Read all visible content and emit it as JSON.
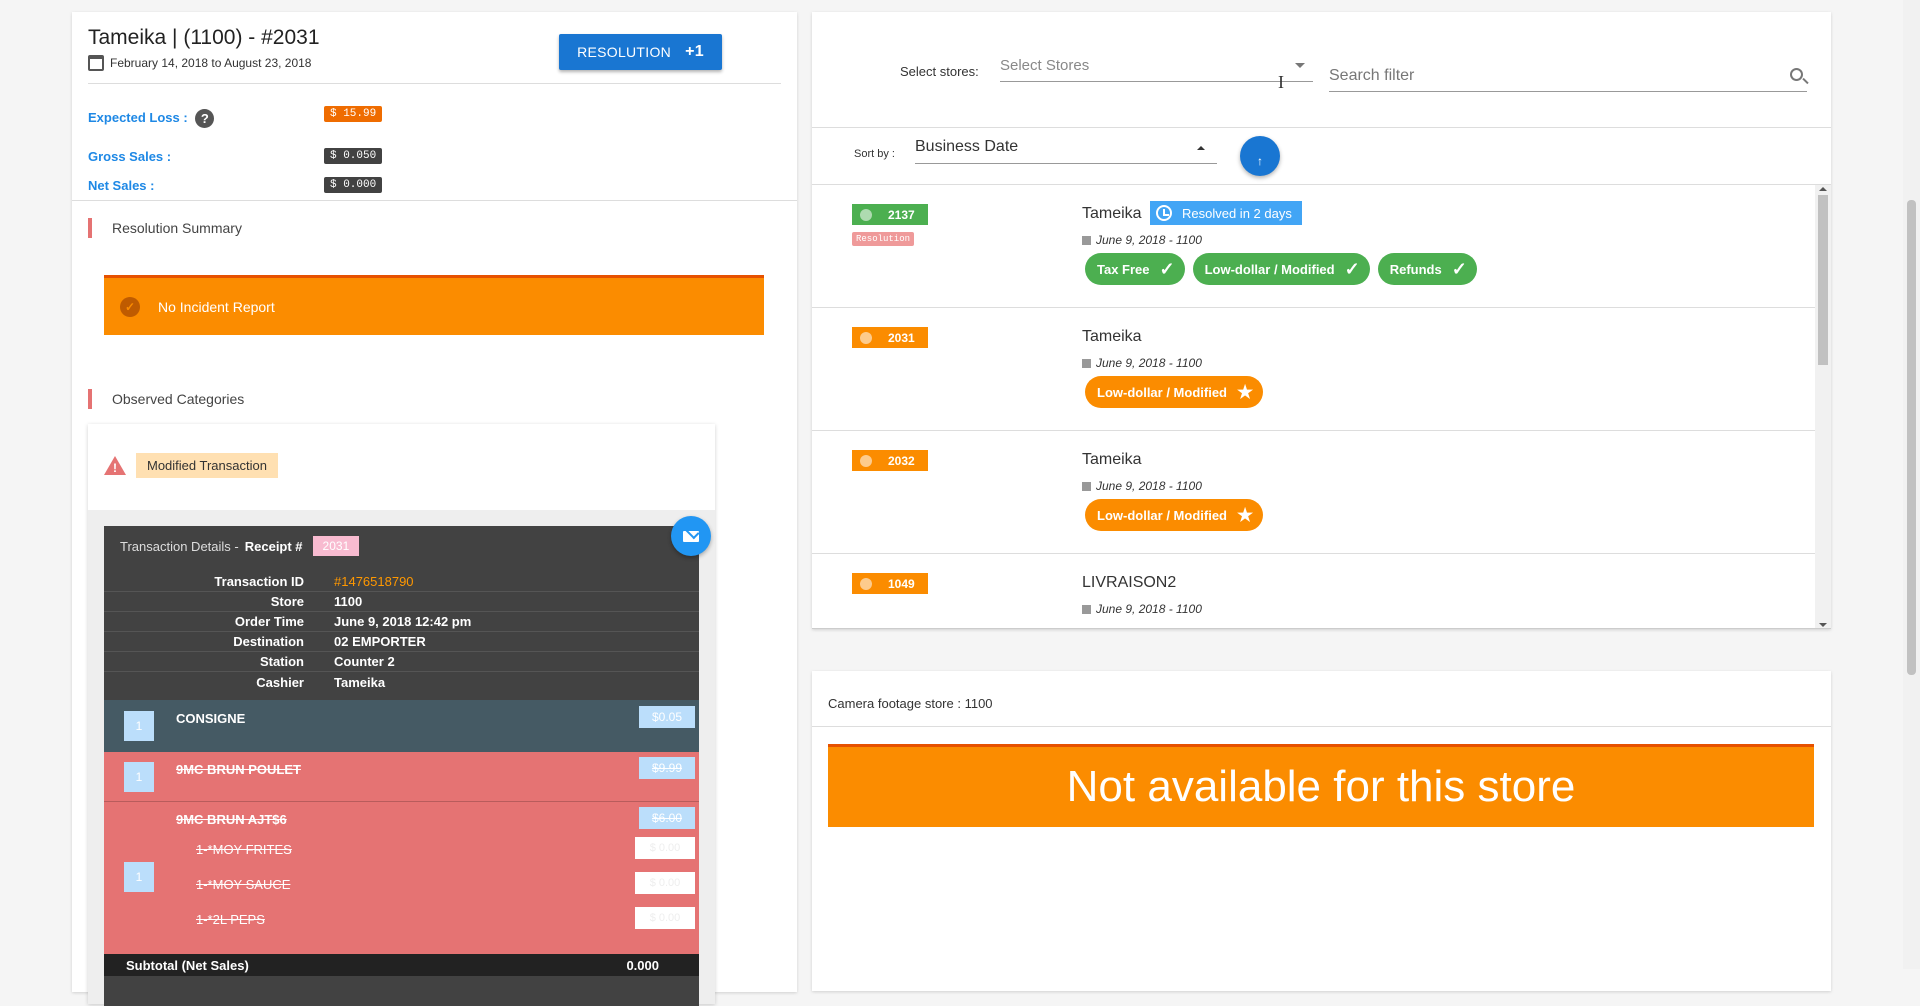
{
  "header": {
    "title": "Tameika | (1100) - #2031",
    "date_range": "February 14, 2018 to August 23, 2018",
    "resolution_button": "RESOLUTION",
    "resolution_count": "+1",
    "expected_loss_label": "Expected Loss :",
    "expected_loss_value": "$ 15.99",
    "gross_sales_label": "Gross Sales :",
    "gross_sales_value": "$ 0.050",
    "net_sales_label": "Net Sales :",
    "net_sales_value": "$ 0.000"
  },
  "resolution_summary": {
    "heading": "Resolution Summary",
    "incident_text": "No Incident Report"
  },
  "observed_categories": {
    "heading": "Observed Categories",
    "category": "Modified Transaction"
  },
  "transaction": {
    "title": "Transaction Details -",
    "receipt_label": "Receipt #",
    "receipt_number": "2031",
    "details": [
      {
        "key": "Transaction ID",
        "value": "#1476518790"
      },
      {
        "key": "Store",
        "value": "1100"
      },
      {
        "key": "Order Time",
        "value": "June 9, 2018 12:42 pm"
      },
      {
        "key": "Destination",
        "value": "02 EMPORTER"
      },
      {
        "key": "Station",
        "value": "Counter 2"
      },
      {
        "key": "Cashier",
        "value": "Tameika"
      }
    ],
    "items": [
      {
        "qty": "1",
        "name": "CONSIGNE",
        "price": "$0.05"
      },
      {
        "qty": "1",
        "name": "9MC BRUN POULET",
        "price": "$9.99"
      },
      {
        "qty": "1",
        "name": "9MC BRUN AJT$6",
        "price": "$6.00",
        "modifiers": [
          {
            "name": "1-*MOY FRITES",
            "price": "$ 0.00"
          },
          {
            "name": "1-*MOY SAUCE",
            "price": "$ 0.00"
          },
          {
            "name": "1-*2L PEPS",
            "price": "$ 0.00"
          }
        ]
      }
    ],
    "subtotal_label": "Subtotal (Net Sales)",
    "subtotal_value": "0.000"
  },
  "filters": {
    "store_label": "Select stores:",
    "store_placeholder": "Select Stores",
    "search_placeholder": "Search filter",
    "sort_label": "Sort by :",
    "sort_value": "Business Date"
  },
  "tickets": [
    {
      "id": "2137",
      "status": "green",
      "tag": "Resolution",
      "name": "Tameika",
      "resolved": "Resolved in 2 days",
      "date": "June 9, 2018 - 1100",
      "chips": [
        {
          "label": "Tax Free",
          "color": "green"
        },
        {
          "label": "Low-dollar / Modified",
          "color": "green"
        },
        {
          "label": "Refunds",
          "color": "green"
        }
      ]
    },
    {
      "id": "2031",
      "status": "orange",
      "name": "Tameika",
      "date": "June 9, 2018 - 1100",
      "chips": [
        {
          "label": "Low-dollar / Modified",
          "color": "orange"
        }
      ]
    },
    {
      "id": "2032",
      "status": "orange",
      "name": "Tameika",
      "date": "June 9, 2018 - 1100",
      "chips": [
        {
          "label": "Low-dollar / Modified",
          "color": "orange"
        }
      ]
    },
    {
      "id": "1049",
      "status": "orange",
      "name": "LIVRAISON2",
      "date": "June 9, 2018 - 1100",
      "chips": []
    }
  ],
  "camera": {
    "label": "Camera footage store : 1100",
    "banner": "Not available for this store"
  },
  "colors": {
    "accent_blue": "#1976d2",
    "orange": "#fb8c00",
    "green": "#4caf50",
    "red": "#e57373"
  }
}
